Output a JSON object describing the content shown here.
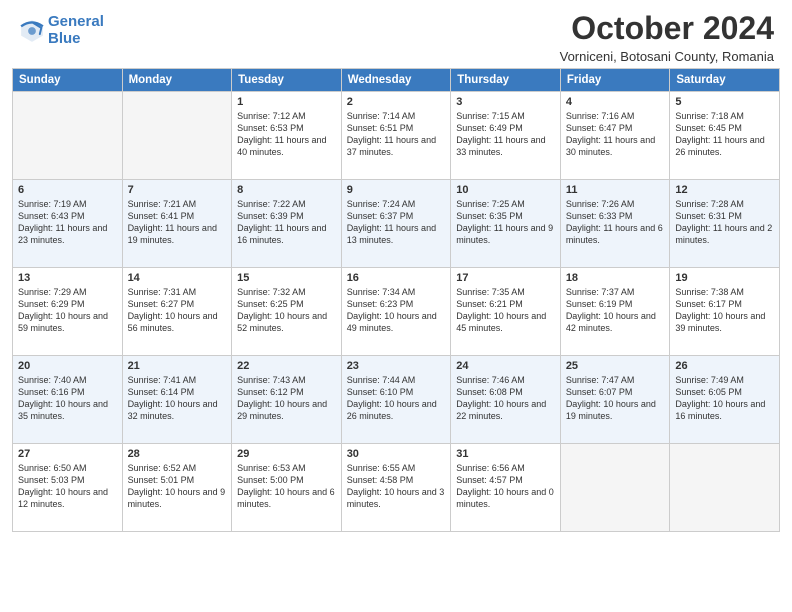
{
  "header": {
    "logo_line1": "General",
    "logo_line2": "Blue",
    "month": "October 2024",
    "location": "Vorniceni, Botosani County, Romania"
  },
  "days_of_week": [
    "Sunday",
    "Monday",
    "Tuesday",
    "Wednesday",
    "Thursday",
    "Friday",
    "Saturday"
  ],
  "weeks": [
    [
      {
        "day": "",
        "info": ""
      },
      {
        "day": "",
        "info": ""
      },
      {
        "day": "1",
        "info": "Sunrise: 7:12 AM\nSunset: 6:53 PM\nDaylight: 11 hours and 40 minutes."
      },
      {
        "day": "2",
        "info": "Sunrise: 7:14 AM\nSunset: 6:51 PM\nDaylight: 11 hours and 37 minutes."
      },
      {
        "day": "3",
        "info": "Sunrise: 7:15 AM\nSunset: 6:49 PM\nDaylight: 11 hours and 33 minutes."
      },
      {
        "day": "4",
        "info": "Sunrise: 7:16 AM\nSunset: 6:47 PM\nDaylight: 11 hours and 30 minutes."
      },
      {
        "day": "5",
        "info": "Sunrise: 7:18 AM\nSunset: 6:45 PM\nDaylight: 11 hours and 26 minutes."
      }
    ],
    [
      {
        "day": "6",
        "info": "Sunrise: 7:19 AM\nSunset: 6:43 PM\nDaylight: 11 hours and 23 minutes."
      },
      {
        "day": "7",
        "info": "Sunrise: 7:21 AM\nSunset: 6:41 PM\nDaylight: 11 hours and 19 minutes."
      },
      {
        "day": "8",
        "info": "Sunrise: 7:22 AM\nSunset: 6:39 PM\nDaylight: 11 hours and 16 minutes."
      },
      {
        "day": "9",
        "info": "Sunrise: 7:24 AM\nSunset: 6:37 PM\nDaylight: 11 hours and 13 minutes."
      },
      {
        "day": "10",
        "info": "Sunrise: 7:25 AM\nSunset: 6:35 PM\nDaylight: 11 hours and 9 minutes."
      },
      {
        "day": "11",
        "info": "Sunrise: 7:26 AM\nSunset: 6:33 PM\nDaylight: 11 hours and 6 minutes."
      },
      {
        "day": "12",
        "info": "Sunrise: 7:28 AM\nSunset: 6:31 PM\nDaylight: 11 hours and 2 minutes."
      }
    ],
    [
      {
        "day": "13",
        "info": "Sunrise: 7:29 AM\nSunset: 6:29 PM\nDaylight: 10 hours and 59 minutes."
      },
      {
        "day": "14",
        "info": "Sunrise: 7:31 AM\nSunset: 6:27 PM\nDaylight: 10 hours and 56 minutes."
      },
      {
        "day": "15",
        "info": "Sunrise: 7:32 AM\nSunset: 6:25 PM\nDaylight: 10 hours and 52 minutes."
      },
      {
        "day": "16",
        "info": "Sunrise: 7:34 AM\nSunset: 6:23 PM\nDaylight: 10 hours and 49 minutes."
      },
      {
        "day": "17",
        "info": "Sunrise: 7:35 AM\nSunset: 6:21 PM\nDaylight: 10 hours and 45 minutes."
      },
      {
        "day": "18",
        "info": "Sunrise: 7:37 AM\nSunset: 6:19 PM\nDaylight: 10 hours and 42 minutes."
      },
      {
        "day": "19",
        "info": "Sunrise: 7:38 AM\nSunset: 6:17 PM\nDaylight: 10 hours and 39 minutes."
      }
    ],
    [
      {
        "day": "20",
        "info": "Sunrise: 7:40 AM\nSunset: 6:16 PM\nDaylight: 10 hours and 35 minutes."
      },
      {
        "day": "21",
        "info": "Sunrise: 7:41 AM\nSunset: 6:14 PM\nDaylight: 10 hours and 32 minutes."
      },
      {
        "day": "22",
        "info": "Sunrise: 7:43 AM\nSunset: 6:12 PM\nDaylight: 10 hours and 29 minutes."
      },
      {
        "day": "23",
        "info": "Sunrise: 7:44 AM\nSunset: 6:10 PM\nDaylight: 10 hours and 26 minutes."
      },
      {
        "day": "24",
        "info": "Sunrise: 7:46 AM\nSunset: 6:08 PM\nDaylight: 10 hours and 22 minutes."
      },
      {
        "day": "25",
        "info": "Sunrise: 7:47 AM\nSunset: 6:07 PM\nDaylight: 10 hours and 19 minutes."
      },
      {
        "day": "26",
        "info": "Sunrise: 7:49 AM\nSunset: 6:05 PM\nDaylight: 10 hours and 16 minutes."
      }
    ],
    [
      {
        "day": "27",
        "info": "Sunrise: 6:50 AM\nSunset: 5:03 PM\nDaylight: 10 hours and 12 minutes."
      },
      {
        "day": "28",
        "info": "Sunrise: 6:52 AM\nSunset: 5:01 PM\nDaylight: 10 hours and 9 minutes."
      },
      {
        "day": "29",
        "info": "Sunrise: 6:53 AM\nSunset: 5:00 PM\nDaylight: 10 hours and 6 minutes."
      },
      {
        "day": "30",
        "info": "Sunrise: 6:55 AM\nSunset: 4:58 PM\nDaylight: 10 hours and 3 minutes."
      },
      {
        "day": "31",
        "info": "Sunrise: 6:56 AM\nSunset: 4:57 PM\nDaylight: 10 hours and 0 minutes."
      },
      {
        "day": "",
        "info": ""
      },
      {
        "day": "",
        "info": ""
      }
    ]
  ]
}
